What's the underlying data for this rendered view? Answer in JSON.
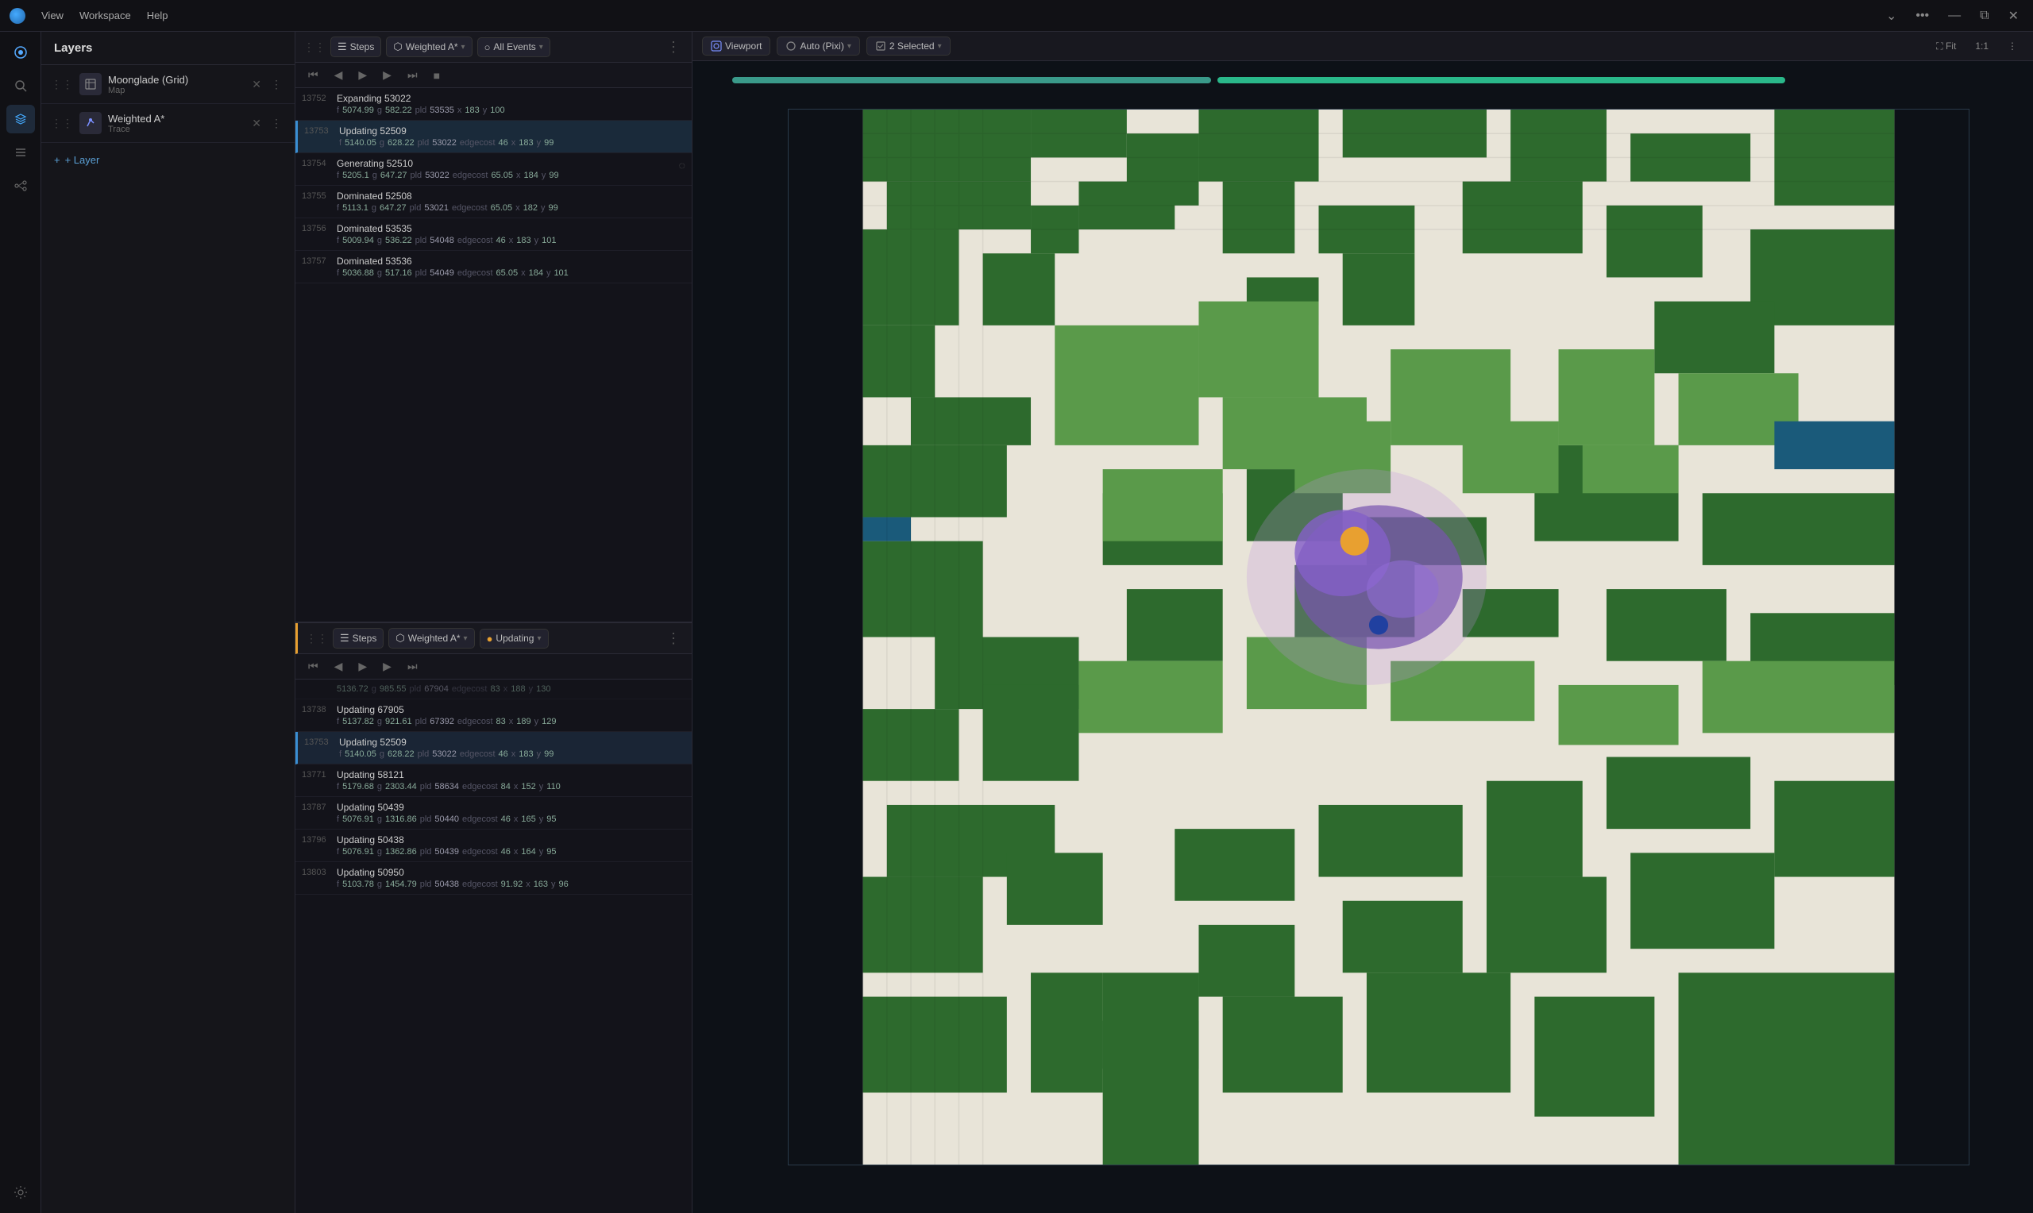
{
  "titlebar": {
    "menu_items": [
      "View",
      "Workspace",
      "Help"
    ],
    "window_controls": [
      "collapse",
      "more",
      "minimize",
      "maximize",
      "close"
    ]
  },
  "layers_panel": {
    "title": "Layers",
    "layers": [
      {
        "id": "layer-map",
        "name": "Moonglade (Grid)",
        "type": "Map",
        "icon": "grid-icon"
      },
      {
        "id": "layer-trace",
        "name": "Weighted A*",
        "type": "Trace",
        "icon": "trace-icon"
      }
    ],
    "add_label": "+ Layer"
  },
  "panel1": {
    "toolbar": {
      "steps_label": "Steps",
      "algo_label": "Weighted A*",
      "events_label": "All Events",
      "step_value": "13753"
    },
    "rows": [
      {
        "index": "13752",
        "title": "Expanding 53022",
        "f": "5074.99",
        "g": "582.22",
        "pld": "53535",
        "x": "183",
        "y": "100",
        "edgecost": null
      },
      {
        "index": "13753",
        "title": "Updating 52509",
        "f": "5140.05",
        "g": "628.22",
        "pld": "53022",
        "edgecost": "46",
        "x": "183",
        "y": "99",
        "selected": true
      },
      {
        "index": "13754",
        "title": "Generating 52510",
        "f": "5205.1",
        "g": "647.27",
        "pld": "53022",
        "edgecost": "65.05",
        "x": "184",
        "y": "99",
        "loading": true
      },
      {
        "index": "13755",
        "title": "Dominated 52508",
        "f": "5113.1",
        "g": "647.27",
        "pld": "53021",
        "edgecost": "65.05",
        "x": "182",
        "y": "99"
      },
      {
        "index": "13756",
        "title": "Dominated 53535",
        "f": "5009.94",
        "g": "536.22",
        "pld": "54048",
        "edgecost": "46",
        "x": "183",
        "y": "101"
      },
      {
        "index": "13757",
        "title": "Dominated 53536",
        "f": "5036.88",
        "g": "517.16",
        "pld": "54049",
        "edgecost": "65.05",
        "x": "184",
        "y": "101"
      }
    ]
  },
  "panel2": {
    "toolbar": {
      "steps_label": "Steps",
      "algo_label": "Weighted A*",
      "events_label": "Updating",
      "step_value": "13753"
    },
    "rows": [
      {
        "index": "13738",
        "title": "Updating 67905",
        "f": "5137.82",
        "g": "921.61",
        "pld": "67392",
        "edgecost": "83",
        "x": "189",
        "y": "129"
      },
      {
        "index": "13753",
        "title": "Updating 52509",
        "f": "5140.05",
        "g": "628.22",
        "pld": "53022",
        "edgecost": "46",
        "x": "183",
        "y": "99",
        "selected": true
      },
      {
        "index": "13771",
        "title": "Updating 58121",
        "f": "5179.68",
        "g": "2303.44",
        "pld": "58634",
        "edgecost": "84",
        "x": "152",
        "y": "110"
      },
      {
        "index": "13787",
        "title": "Updating 50439",
        "f": "5076.91",
        "g": "1316.86",
        "pld": "50440",
        "edgecost": "46",
        "x": "165",
        "y": "95"
      },
      {
        "index": "13796",
        "title": "Updating 50438",
        "f": "5076.91",
        "g": "1362.86",
        "pld": "50439",
        "edgecost": "46",
        "x": "164",
        "y": "95"
      },
      {
        "index": "13803",
        "title": "Updating 50950",
        "f": "5103.78",
        "g": "1454.79",
        "pld": "50438",
        "edgecost": "91.92",
        "x": "163",
        "y": "96"
      }
    ]
  },
  "viewport": {
    "title": "Viewport",
    "render_label": "Auto (Pixi)",
    "selected_label": "2 Selected",
    "fit_label": "Fit",
    "zoom_label": "1:1",
    "timeline_bars": [
      {
        "color": "#3a9a8a",
        "width": "38%"
      },
      {
        "color": "#2ab88a",
        "width": "45%"
      }
    ]
  },
  "icons": {
    "drag": "⋮⋮",
    "grid": "▦",
    "trace": "↗",
    "close": "✕",
    "more_vert": "⋮",
    "chevron_down": "▾",
    "play": "▶",
    "prev": "◀",
    "next": "▶",
    "first": "⏮",
    "last": "⏭",
    "stop": "■",
    "search": "⌕",
    "layers_icon": "◫",
    "map_icon": "◫",
    "eye": "👁",
    "plus": "+"
  }
}
